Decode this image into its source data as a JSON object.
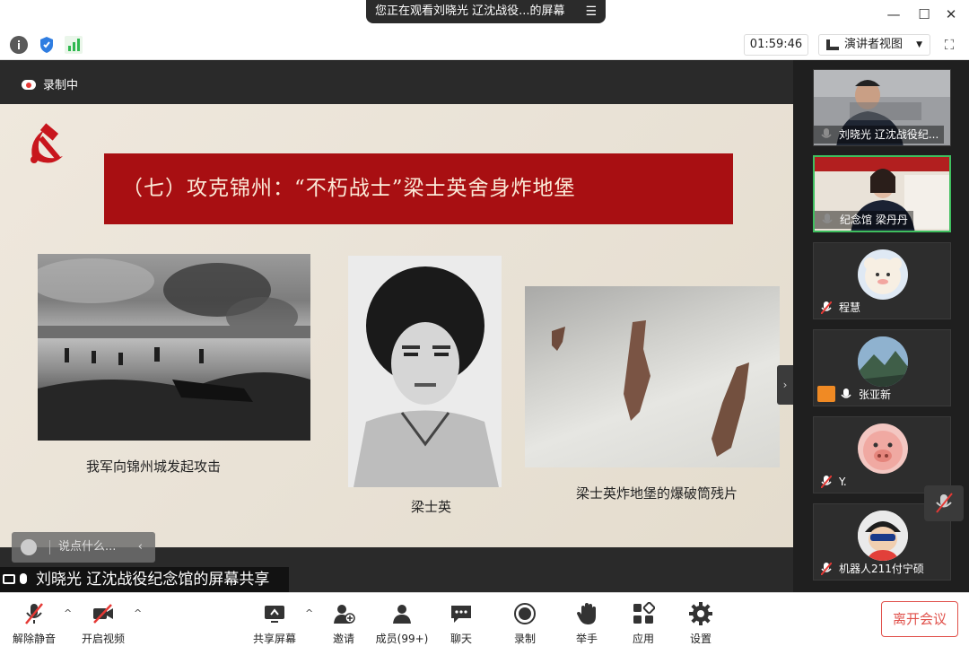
{
  "window": {
    "title": "您正在观看刘晓光 辽沈战役...的屏幕",
    "menu_glyph": "☰",
    "minimize_glyph": "—",
    "maximize_glyph": "☐",
    "close_glyph": "✕"
  },
  "toolbar": {
    "timer": "01:59:46",
    "view_label": "演讲者视图",
    "view_caret": "▼",
    "fullscreen_glyph": "⛶",
    "icons": [
      "info-icon",
      "shield-icon",
      "signal-icon"
    ]
  },
  "share": {
    "recording_label": "录制中",
    "sharer_label": "刘晓光 辽沈战役纪念馆的屏幕共享",
    "collapse_glyph": "›"
  },
  "slide": {
    "title": "（七）攻克锦州：“不朽战士”梁士英舍身炸地堡",
    "captions": {
      "battle": "我军向锦州城发起攻击",
      "portrait": "梁士英",
      "shards": "梁士英炸地堡的爆破筒残片"
    }
  },
  "chat": {
    "placeholder": "说点什么...",
    "arrow": "‹"
  },
  "gallery": {
    "participants": [
      {
        "name": "刘晓光 辽沈战役纪...",
        "muted": false
      },
      {
        "name": "纪念馆 梁丹丹",
        "muted": false
      },
      {
        "name": "程慧",
        "muted": true
      },
      {
        "name": "张亚新",
        "muted": false
      },
      {
        "name": "Y.",
        "muted": true
      },
      {
        "name": "机器人211付宁硕",
        "muted": true
      }
    ]
  },
  "bottom": {
    "items": [
      {
        "label": "解除静音"
      },
      {
        "label": "开启视频"
      },
      {
        "label": "共享屏幕"
      },
      {
        "label": "邀请"
      },
      {
        "label": "成员(99+)"
      },
      {
        "label": "聊天"
      },
      {
        "label": "录制"
      },
      {
        "label": "举手"
      },
      {
        "label": "应用"
      },
      {
        "label": "设置"
      }
    ],
    "caret": "^",
    "leave_label": "离开会议"
  },
  "colors": {
    "slide_title_bg": "#a80f12",
    "active_border": "#3fbf5f",
    "leave_red": "#e0504a",
    "mute_red": "#e53935"
  }
}
